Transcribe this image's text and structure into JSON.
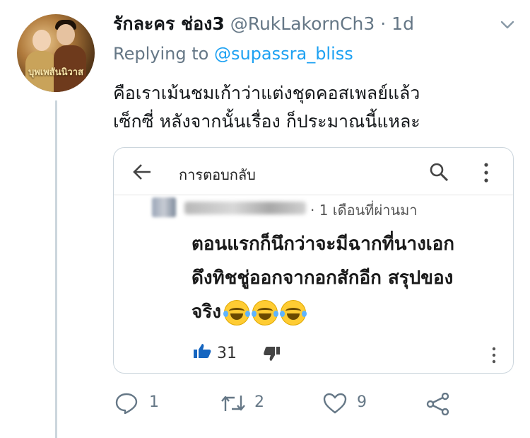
{
  "tweet": {
    "display_name": "รักละคร ช่อง3",
    "handle": "@RukLakornCh3",
    "separator": "·",
    "time": "1d",
    "avatar_text": "บุพเพสันนิวาส",
    "replying_prefix": "Replying to",
    "replying_handle": "@supassra_bliss",
    "text_lines": [
      "คือเราเม้นชมเก้าว่าแต่งชุดคอสเพลย์แล้ว",
      "เซ็กซี่ หลังจากนั้นเรื่อง ก็ประมาณนี้แหละ"
    ]
  },
  "embedded_screenshot": {
    "title": "การตอบกลับ",
    "time_ago": "· 1 เดือนที่ผ่านมา",
    "comment_lines": [
      "ตอนแรกก็นึกว่าจะมีฉากที่นางเอก",
      "ดึงทิชชู่ออกจากอกสักอีก สรุปของ",
      "จริง"
    ],
    "emoji_icon": "face-with-tears-of-joy-icon",
    "like_count": "31"
  },
  "actions": {
    "reply_count": "1",
    "retweet_count": "2",
    "like_count": "9"
  },
  "colors": {
    "primary_text": "#14171a",
    "secondary_text": "#657786",
    "mention": "#1da1f2",
    "thread_line": "#ccd6dd",
    "youtube_like_blue": "#1565c0"
  }
}
